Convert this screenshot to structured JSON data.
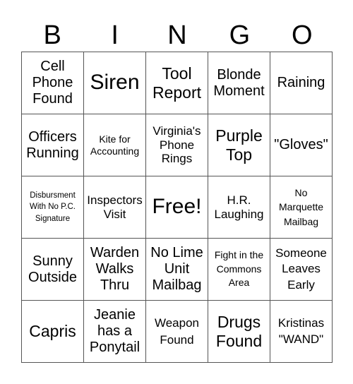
{
  "header": {
    "letters": [
      "B",
      "I",
      "N",
      "G",
      "O"
    ]
  },
  "grid": {
    "rows": [
      [
        "Cell Phone Found",
        "Siren",
        "Tool Report",
        "Blonde Moment",
        "Raining"
      ],
      [
        "Officers Running",
        "Kite for Accounting",
        "Virginia's Phone Rings",
        "Purple Top",
        "\"Gloves\""
      ],
      [
        "Disbursment With No P.C. Signature",
        "Inspectors Visit",
        "Free!",
        "H.R. Laughing",
        "No Marquette Mailbag"
      ],
      [
        "Sunny Outside",
        "Warden Walks Thru",
        "No Lime Unit Mailbag",
        "Fight in the Commons Area",
        "Someone Leaves Early"
      ],
      [
        "Capris",
        "Jeanie has a Ponytail",
        "Weapon Found",
        "Drugs Found",
        "Kristinas \"WAND\""
      ]
    ]
  }
}
